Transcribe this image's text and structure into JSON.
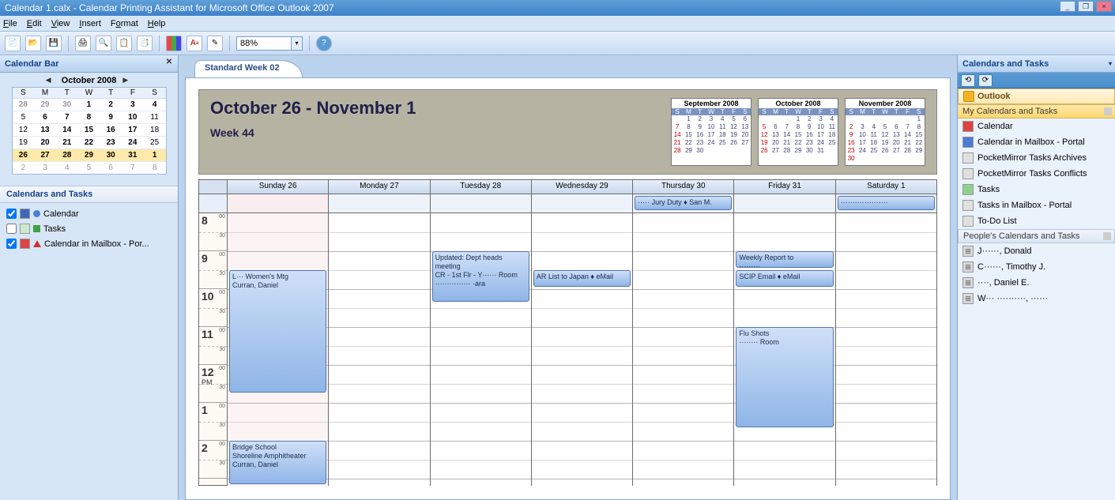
{
  "app": {
    "title": "Calendar 1.calx - Calendar Printing Assistant for Microsoft Office Outlook 2007"
  },
  "menu": {
    "file": "File",
    "edit": "Edit",
    "view": "View",
    "insert": "Insert",
    "format": "Format",
    "help": "Help"
  },
  "toolbar": {
    "zoom": "88%"
  },
  "left": {
    "panel_title": "Calendar Bar",
    "month_title": "October 2008",
    "daynames": [
      "S",
      "M",
      "T",
      "W",
      "T",
      "F",
      "S"
    ],
    "weeks": [
      {
        "hl": false,
        "days": [
          {
            "n": "28",
            "o": true,
            "b": true
          },
          {
            "n": "29",
            "o": true,
            "b": true
          },
          {
            "n": "30",
            "o": true,
            "b": true
          },
          {
            "n": "1",
            "b": true
          },
          {
            "n": "2",
            "b": true
          },
          {
            "n": "3",
            "b": true
          },
          {
            "n": "4",
            "b": true
          }
        ]
      },
      {
        "hl": false,
        "days": [
          {
            "n": "5",
            "b": false
          },
          {
            "n": "6",
            "b": true
          },
          {
            "n": "7",
            "b": true
          },
          {
            "n": "8",
            "b": true
          },
          {
            "n": "9",
            "b": true
          },
          {
            "n": "10",
            "b": true
          },
          {
            "n": "11",
            "b": false
          }
        ]
      },
      {
        "hl": false,
        "days": [
          {
            "n": "12"
          },
          {
            "n": "13",
            "b": true
          },
          {
            "n": "14",
            "b": true
          },
          {
            "n": "15",
            "b": true
          },
          {
            "n": "16",
            "b": true
          },
          {
            "n": "17",
            "b": true
          },
          {
            "n": "18"
          }
        ]
      },
      {
        "hl": false,
        "days": [
          {
            "n": "19"
          },
          {
            "n": "20",
            "b": true
          },
          {
            "n": "21",
            "b": true
          },
          {
            "n": "22",
            "b": true
          },
          {
            "n": "23",
            "b": true
          },
          {
            "n": "24",
            "b": true
          },
          {
            "n": "25"
          }
        ]
      },
      {
        "hl": true,
        "days": [
          {
            "n": "26",
            "b": true
          },
          {
            "n": "27",
            "b": true
          },
          {
            "n": "28",
            "b": true
          },
          {
            "n": "29",
            "b": true
          },
          {
            "n": "30",
            "b": true
          },
          {
            "n": "31",
            "b": true
          },
          {
            "n": "1",
            "b": true
          }
        ]
      },
      {
        "hl": false,
        "days": [
          {
            "n": "2",
            "o": true
          },
          {
            "n": "3",
            "o": true
          },
          {
            "n": "4",
            "o": true
          },
          {
            "n": "5",
            "o": true
          },
          {
            "n": "6",
            "o": true
          },
          {
            "n": "7",
            "o": true
          },
          {
            "n": "8",
            "o": true
          }
        ]
      }
    ],
    "cal_tasks_title": "Calendars and Tasks",
    "items": [
      {
        "checked": true,
        "label": "Calendar"
      },
      {
        "checked": false,
        "label": "Tasks"
      },
      {
        "checked": true,
        "label": "Calendar in Mailbox - Por..."
      }
    ]
  },
  "center": {
    "tab": "Standard Week 02",
    "header_range": "October 26 - November 1",
    "header_week": "Week 44",
    "months": [
      {
        "name": "September 2008",
        "rows": [
          [
            "",
            "1",
            "2",
            "3",
            "4",
            "5",
            "6"
          ],
          [
            "7",
            "8",
            "9",
            "10",
            "11",
            "12",
            "13"
          ],
          [
            "14",
            "15",
            "16",
            "17",
            "18",
            "19",
            "20"
          ],
          [
            "21",
            "22",
            "23",
            "24",
            "25",
            "26",
            "27"
          ],
          [
            "28",
            "29",
            "30",
            "",
            "",
            "",
            ""
          ]
        ]
      },
      {
        "name": "October 2008",
        "rows": [
          [
            "",
            "",
            "",
            "1",
            "2",
            "3",
            "4"
          ],
          [
            "5",
            "6",
            "7",
            "8",
            "9",
            "10",
            "11"
          ],
          [
            "12",
            "13",
            "14",
            "15",
            "16",
            "17",
            "18"
          ],
          [
            "19",
            "20",
            "21",
            "22",
            "23",
            "24",
            "25"
          ],
          [
            "26",
            "27",
            "28",
            "29",
            "30",
            "31",
            ""
          ]
        ]
      },
      {
        "name": "November 2008",
        "rows": [
          [
            "",
            "",
            "",
            "",
            "",
            "",
            "1"
          ],
          [
            "2",
            "3",
            "4",
            "5",
            "6",
            "7",
            "8"
          ],
          [
            "9",
            "10",
            "11",
            "12",
            "13",
            "14",
            "15"
          ],
          [
            "16",
            "17",
            "18",
            "19",
            "20",
            "21",
            "22"
          ],
          [
            "23",
            "24",
            "25",
            "26",
            "27",
            "28",
            "29"
          ],
          [
            "30",
            "",
            "",
            "",
            "",
            "",
            ""
          ]
        ]
      }
    ],
    "day_th": [
      "S",
      "M",
      "T",
      "W",
      "T",
      "F",
      "S"
    ],
    "days": [
      "Sunday 26",
      "Monday 27",
      "Tuesday 28",
      "Wednesday 29",
      "Thursday 30",
      "Friday 31",
      "Saturday 1"
    ],
    "hours": [
      "8",
      "9",
      "10",
      "11",
      "12 PM",
      "1",
      "2"
    ],
    "allday": {
      "thu": "····· Jury Duty ♦ San M.",
      "sat": "····················"
    },
    "appts": {
      "sun_womens": "L··· Women's Mtg\nCurran, Daniel",
      "sun_bridge": "Bridge School\nShoreline Amphitheater\nCurran, Daniel",
      "tue_dept": "Updated: Dept heads meeting\nCR - 1st Flr - Y······ Room\n··············· ·ara",
      "wed_ar": "AR List to Japan ♦ eMail",
      "fri_report": "Weekly Report to\n·········",
      "fri_scip": "SCIP Email ♦ eMail",
      "fri_flu": "Flu Shots\n········ Room"
    }
  },
  "right": {
    "panel_title": "Calendars and Tasks",
    "outlook": "Outlook",
    "my_hdr": "My Calendars and Tasks",
    "my_items": [
      "Calendar",
      "Calendar in Mailbox - Portal",
      "PocketMirror Tasks Archives",
      "PocketMirror Tasks Conflicts",
      "Tasks",
      "Tasks in Mailbox - Portal",
      "To-Do List"
    ],
    "people_hdr": "People's Calendars and Tasks",
    "people_items": [
      "J······, Donald",
      "C······, Timothy J.",
      "····, Daniel E.",
      "W··· ··········, ······"
    ]
  }
}
